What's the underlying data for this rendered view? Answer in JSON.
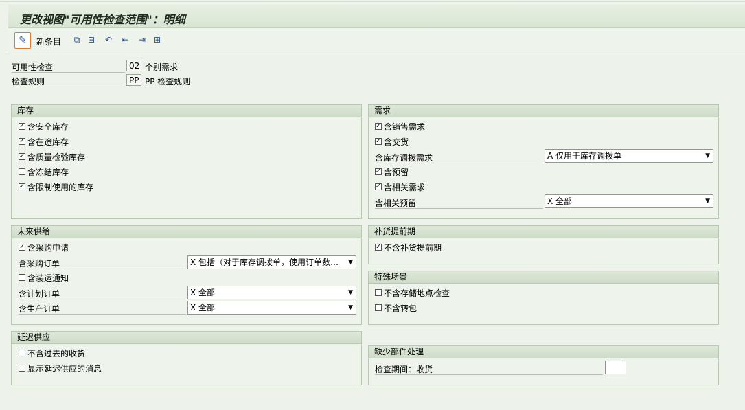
{
  "title": "更改视图\"可用性检查范围\"：明细",
  "toolbar": {
    "new_entries_label": "新条目"
  },
  "header": {
    "availability_check_label": "可用性检查",
    "availability_check_code": "02",
    "availability_check_desc": "个别需求",
    "checking_rule_label": "检查规则",
    "checking_rule_code": "PP",
    "checking_rule_desc": "PP 检查规则"
  },
  "stock": {
    "title": "库存",
    "items": [
      {
        "label": "含安全库存",
        "checked": true
      },
      {
        "label": "含在途库存",
        "checked": true
      },
      {
        "label": "含质量检验库存",
        "checked": true
      },
      {
        "label": "含冻结库存",
        "checked": false
      },
      {
        "label": "含限制使用的库存",
        "checked": true
      }
    ]
  },
  "requirements": {
    "title": "需求",
    "incl_sales_label": "含销售需求",
    "incl_sales_checked": true,
    "incl_deliveries_label": "含交货",
    "incl_deliveries_checked": true,
    "stock_transfer_label": "含库存调拨需求",
    "stock_transfer_value": "A 仅用于库存调拨单",
    "incl_reservations_label": "含预留",
    "incl_reservations_checked": true,
    "incl_dependent_req_label": "含相关需求",
    "incl_dependent_req_checked": true,
    "dependent_reservations_label": "含相关预留",
    "dependent_reservations_value": "X 全部"
  },
  "receipts": {
    "title": "未来供给",
    "incl_purch_req_label": "含采购申请",
    "incl_purch_req_checked": true,
    "purch_orders_label": "含采购订单",
    "purch_orders_value": "X 包括（对于库存调拨单，使用订单数量…",
    "incl_shipping_label": "含装运通知",
    "incl_shipping_checked": false,
    "planned_orders_label": "含计划订单",
    "planned_orders_value": "X 全部",
    "production_orders_label": "含生产订单",
    "production_orders_value": "X 全部"
  },
  "rlt": {
    "title": "补货提前期",
    "label": "不含补货提前期",
    "checked": true
  },
  "special": {
    "title": "特殊场景",
    "items": [
      {
        "label": "不含存储地点检查",
        "checked": false
      },
      {
        "label": "不含转包",
        "checked": false
      }
    ]
  },
  "past": {
    "title": "延迟供应",
    "items": [
      {
        "label": "不含过去的收货",
        "checked": false
      },
      {
        "label": "显示延迟供应的消息",
        "checked": false
      }
    ]
  },
  "missing_parts": {
    "title": "缺少部件处理",
    "label": "检查期间：收货",
    "value": ""
  }
}
